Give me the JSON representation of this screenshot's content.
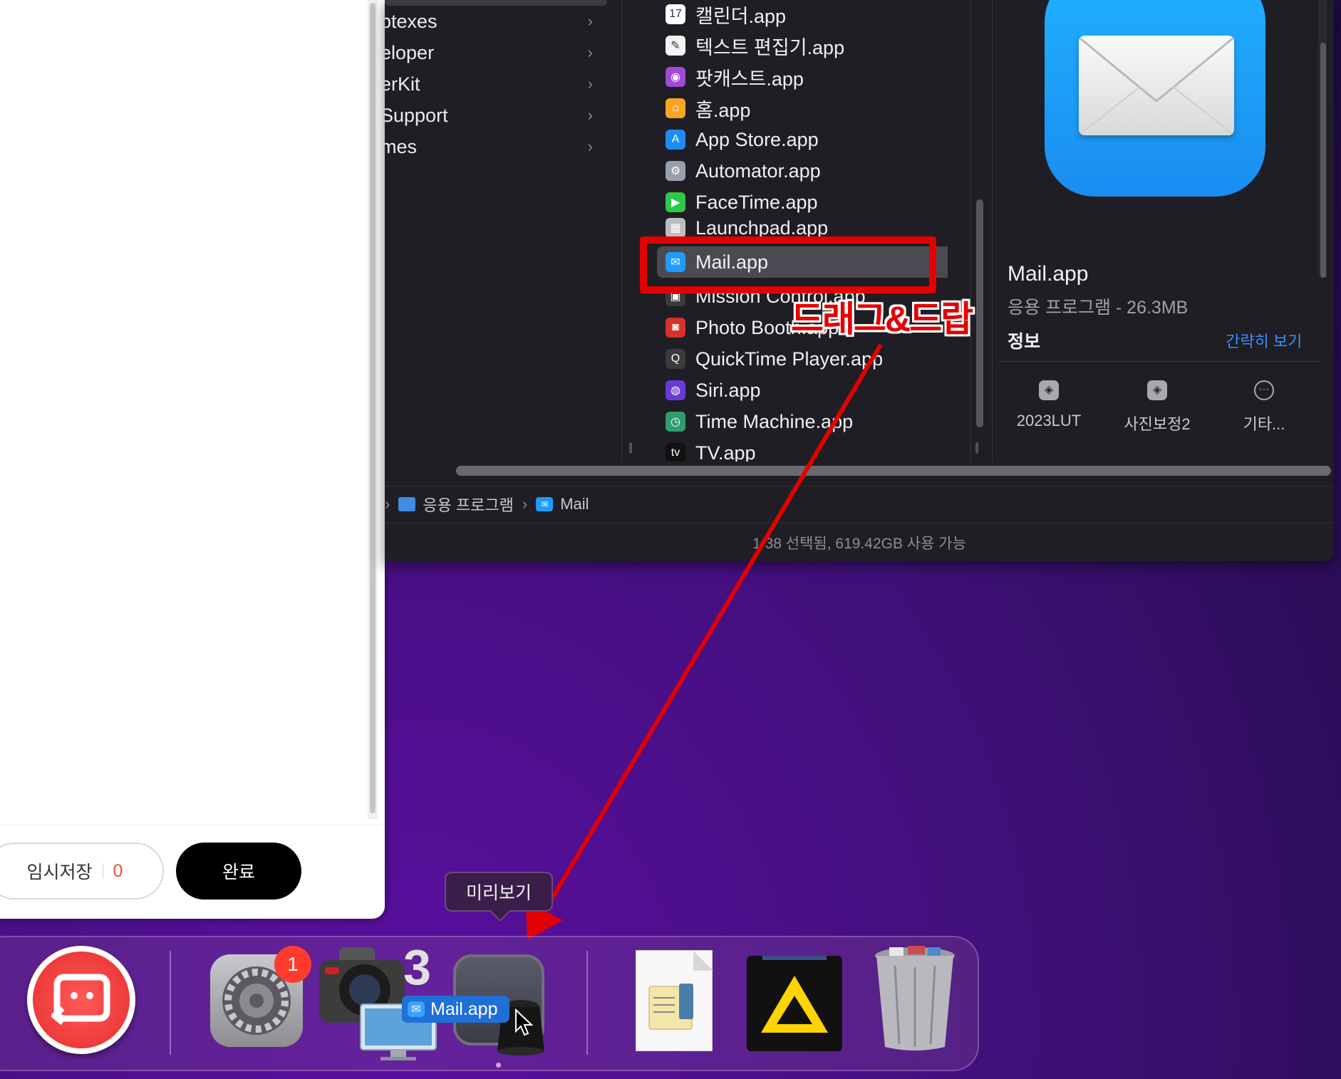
{
  "editor": {
    "save_label": "임시저장",
    "save_count": "0",
    "done_label": "완료"
  },
  "finder": {
    "sidebar_items": [
      {
        "label": "ptexes"
      },
      {
        "label": "eloper"
      },
      {
        "label": "erKit"
      },
      {
        "label": "Support"
      },
      {
        "label": "mes"
      }
    ],
    "files": [
      {
        "label": "캘린더.app",
        "icon": "calendar-icon",
        "color": "#ffffff"
      },
      {
        "label": "텍스트 편집기.app",
        "icon": "textedit-icon",
        "color": "#f4f4f4"
      },
      {
        "label": "팟캐스트.app",
        "icon": "podcast-icon",
        "color": "#a04ad8"
      },
      {
        "label": "홈.app",
        "icon": "home-icon",
        "color": "#f6a623"
      },
      {
        "label": "App Store.app",
        "icon": "appstore-icon",
        "color": "#1e8cf5"
      },
      {
        "label": "Automator.app",
        "icon": "automator-icon",
        "color": "#9aa0ab"
      },
      {
        "label": "FaceTime.app",
        "icon": "facetime-icon",
        "color": "#2ec84a"
      },
      {
        "label": "Launchpad.app",
        "icon": "launchpad-icon",
        "color": "#bdbdbd"
      },
      {
        "label": "Mail.app",
        "icon": "mail-icon",
        "color": "#1f9bff"
      },
      {
        "label": "Mission Control.app",
        "icon": "mission-control-icon",
        "color": "#3a3a3a"
      },
      {
        "label": "Photo Booth.app",
        "icon": "photobooth-icon",
        "color": "#d8302a"
      },
      {
        "label": "QuickTime Player.app",
        "icon": "quicktime-icon",
        "color": "#3b3b3b"
      },
      {
        "label": "Siri.app",
        "icon": "siri-icon",
        "color": "#6a3ad8"
      },
      {
        "label": "Time Machine.app",
        "icon": "timemachine-icon",
        "color": "#2f9e6e"
      },
      {
        "label": "TV.app",
        "icon": "tv-icon",
        "color": "#111111"
      }
    ],
    "preview": {
      "name": "Mail.app",
      "kind": "응용 프로그램 - 26.3MB",
      "info_label": "정보",
      "show_less": "간략히 보기",
      "actions": [
        {
          "label": "2023LUT",
          "icon": "shortcut-icon"
        },
        {
          "label": "사진보정2",
          "icon": "shortcut-icon"
        },
        {
          "label": "기타...",
          "icon": "more-icon"
        }
      ]
    },
    "path": {
      "folder": "응용 프로그램",
      "item": "Mail"
    },
    "status": "1/38 선택됨, 619.42GB 사용 가능"
  },
  "annotation": {
    "label": "드래그&드랍"
  },
  "dock": {
    "tooltip": "미리보기",
    "drag_label": "Mail.app",
    "sysprefs_badge": "1",
    "camera_badge": "3"
  }
}
